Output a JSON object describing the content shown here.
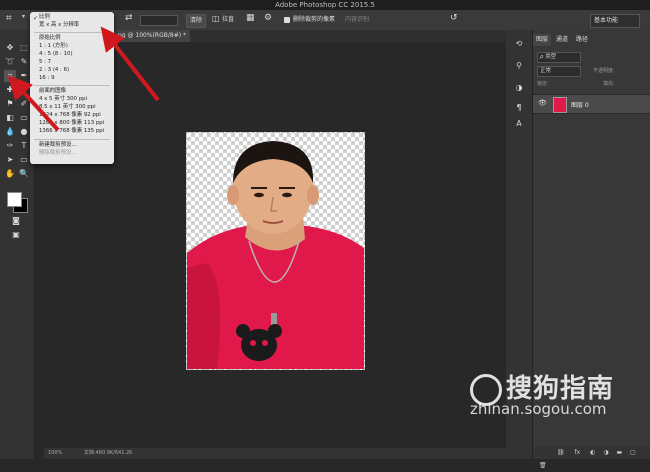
{
  "app": {
    "title": "Adobe Photoshop CC 2015.5"
  },
  "document_tab": {
    "label": "ng @ 100%(RGB/8#) *"
  },
  "options_bar": {
    "clear_label": "清除",
    "straighten_label": "拉直",
    "delete_cropped_label": "删除裁剪的像素",
    "content_aware_label": "内容识别",
    "workspace_label": "基本功能"
  },
  "crop_menu": {
    "items": [
      {
        "label": "比例",
        "checked": true
      },
      {
        "label": "宽 x 高 x 分辨率"
      },
      {
        "label": "原始比例"
      },
      {
        "label": "1 : 1 (方形)"
      },
      {
        "label": "4 : 5 (8 : 10)"
      },
      {
        "label": "5 : 7"
      },
      {
        "label": "2 : 3 (4 : 6)"
      },
      {
        "label": "16 : 9"
      },
      {
        "label": "前面的图像"
      },
      {
        "label": "4 x 5 英寸 300 ppi"
      },
      {
        "label": "8.5 x 11 英寸 300 ppi"
      },
      {
        "label": "1024 x 768 像素 92 ppi"
      },
      {
        "label": "1280 x 800 像素 113 ppi"
      },
      {
        "label": "1366 x 768 像素 135 ppi"
      },
      {
        "label": "新建裁剪预设..."
      },
      {
        "label": "删除裁剪预设..."
      }
    ]
  },
  "layers_panel": {
    "tabs": [
      "图层",
      "通道",
      "路径"
    ],
    "kind_filter": "ρ 类型",
    "blend_mode": "正常",
    "opacity_label": "不透明度:",
    "lock_label": "锁定:",
    "fill_label": "填充:",
    "layer_name": "图层 0"
  },
  "status": {
    "zoom": "100%",
    "doc_info": "文档:480.9K/641.2K"
  },
  "watermark": {
    "brand": "搜狗指南",
    "url": "zhinan.sogou.com"
  },
  "colors": {
    "accent_arrow": "#d0191f",
    "shirt": "#e0194a"
  }
}
